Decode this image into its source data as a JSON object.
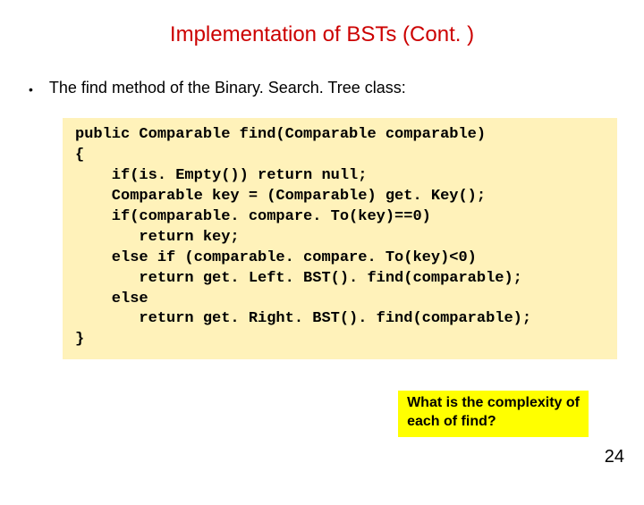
{
  "title": "Implementation of BSTs (Cont. )",
  "bullet": "The find method of the Binary. Search. Tree class:",
  "code": "public Comparable find(Comparable comparable)\n{\n    if(is. Empty()) return null;\n    Comparable key = (Comparable) get. Key();\n    if(comparable. compare. To(key)==0)\n       return key;\n    else if (comparable. compare. To(key)<0)\n       return get. Left. BST(). find(comparable);\n    else\n       return get. Right. BST(). find(comparable);\n}",
  "question_line1": "What is the complexity of",
  "question_line2": " each of find?",
  "page_number": "24",
  "colors": {
    "title": "#cc0000",
    "code_bg": "#fff2ba",
    "highlight": "#ffff00"
  }
}
